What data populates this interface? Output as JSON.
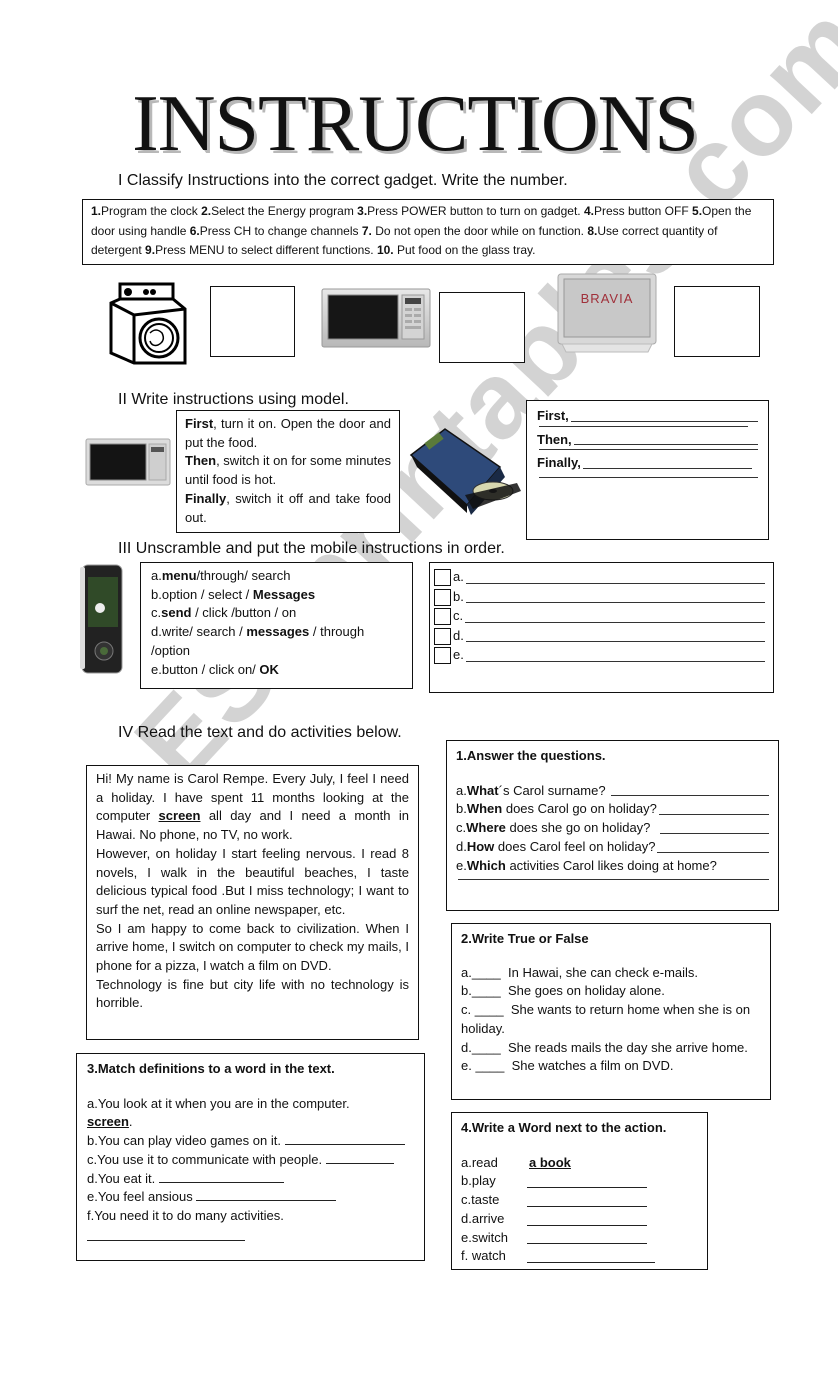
{
  "title": "INSTRUCTIONS",
  "watermark": "ESLprintables.com",
  "section1": {
    "heading": "I Classify  Instructions into the correct gadget. Write the number.",
    "instructions": [
      {
        "num": "1.",
        "text": "Program the clock "
      },
      {
        "num": "2.",
        "text": "Select the Energy program "
      },
      {
        "num": "3.",
        "text": "Press POWER button to turn on gadget. "
      },
      {
        "num": "4.",
        "text": "Press button OFF"
      },
      {
        "num": "5.",
        "text": "Open the door using handle  "
      },
      {
        "num": "6.",
        "text": "Press CH to change channels  "
      },
      {
        "num": "7.",
        "text": " Do not open the door while on function.  "
      },
      {
        "num": "8.",
        "text": "Use correct quantity of detergent  "
      },
      {
        "num": "9.",
        "text": "Press MENU to select different functions.  "
      },
      {
        "num": "10.",
        "text": " Put food on the glass tray."
      }
    ],
    "gadgets": [
      {
        "name": "washing machine",
        "answer": ""
      },
      {
        "name": "microwave",
        "answer": ""
      },
      {
        "name": "television",
        "answer": "",
        "brand": "BRAVIA"
      }
    ]
  },
  "section2": {
    "heading": "II Write instructions using model.",
    "model": {
      "first_word": "First",
      "first_text": ", turn it on. Open the door and put the food.",
      "then_word": "Then",
      "then_text": ", switch it on for some minutes until food is hot.",
      "finally_word": "Finally",
      "finally_text": ", switch it off and take food out."
    },
    "exercise": {
      "first_label": "First,",
      "then_label": "Then,",
      "finally_label": "Finally,"
    }
  },
  "section3": {
    "heading": "III Unscramble and put the mobile instructions in order.",
    "items": [
      {
        "letter": "a.",
        "parts": [
          {
            "t": "menu",
            "b": true
          },
          {
            "t": "/through/ search",
            "b": false
          }
        ]
      },
      {
        "letter": "b.",
        "parts": [
          {
            "t": "option / select / ",
            "b": false
          },
          {
            "t": "Messages",
            "b": true
          }
        ]
      },
      {
        "letter": "c.",
        "parts": [
          {
            "t": "send",
            "b": true
          },
          {
            "t": " / click /button / on",
            "b": false
          }
        ]
      },
      {
        "letter": "d.",
        "parts": [
          {
            "t": "write/ search / ",
            "b": false
          },
          {
            "t": "messages",
            "b": true
          },
          {
            "t": " / through /option",
            "b": false
          }
        ]
      },
      {
        "letter": "e.",
        "parts": [
          {
            "t": "button / click on/ ",
            "b": false
          },
          {
            "t": "OK",
            "b": true
          }
        ]
      }
    ],
    "answer_letters": [
      "a.",
      "b.",
      "c.",
      "d.",
      "e."
    ]
  },
  "section4": {
    "heading": "IV Read the text and do activities below.",
    "reading": {
      "p1_before": "Hi! My name is Carol Rempe. Every July, I feel I need a holiday. I have spent 11 months looking at the computer ",
      "p1_bold": "screen",
      "p1_after": " all day and I need a month in Hawai. No phone, no TV, no work.",
      "p2": "However, on holiday I start feeling nervous. I read 8 novels, I walk in the beautiful beaches, I taste delicious typical food .But I miss technology; I want to surf the net, read an online newspaper, etc.",
      "p3": "So I am happy to come back to civilization. When I arrive home, I switch on computer to check my mails, I phone for a pizza, I watch a film on DVD.",
      "p4": "Technology is fine but city life with no technology is horrible."
    },
    "activity1": {
      "title": "1.Answer the questions.",
      "questions": [
        {
          "letter": "a.",
          "bold": "What",
          "text": "´s Carol surname? "
        },
        {
          "letter": "b.",
          "bold": "When",
          "text": " does Carol go on holiday?"
        },
        {
          "letter": "c.",
          "bold": "Where",
          "text": " does she go on holiday?  "
        },
        {
          "letter": "d.",
          "bold": "How",
          "text": " does Carol feel on holiday?"
        },
        {
          "letter": "e.",
          "bold": "Which",
          "text": " activities Carol likes doing at home?"
        }
      ]
    },
    "activity2": {
      "title": "2.Write True or False",
      "statements": [
        {
          "letter": "a.",
          "blank": "____",
          "text": "  In Hawai, she can check e-mails."
        },
        {
          "letter": "b.",
          "blank": "____",
          "text": "  She goes on holiday alone."
        },
        {
          "letter": "c. ",
          "blank": "____",
          "text": "  She wants to return home when she is on holiday."
        },
        {
          "letter": "d.",
          "blank": "____",
          "text": "  She reads mails the day she arrive home."
        },
        {
          "letter": "e. ",
          "blank": "____",
          "text": "  She watches a film on DVD."
        }
      ]
    },
    "activity3": {
      "title": "3.Match definitions to a word in the text.",
      "example_text": "a.You look at it when you are in the computer.",
      "example_answer": "screen",
      "definitions": [
        {
          "text": "b.You can play video games on it. "
        },
        {
          "text": "c.You use it to communicate with people. "
        },
        {
          "text": "d.You eat it. "
        },
        {
          "text": "e.You feel ansious "
        },
        {
          "text": "f.You need it to do many activities."
        }
      ]
    },
    "activity4": {
      "title": "4.Write a Word next to the action.",
      "example_action": "a.read",
      "example_answer": "a book",
      "actions": [
        "b.play",
        "c.taste",
        "d.arrive",
        "e.switch",
        "f. watch"
      ]
    }
  }
}
